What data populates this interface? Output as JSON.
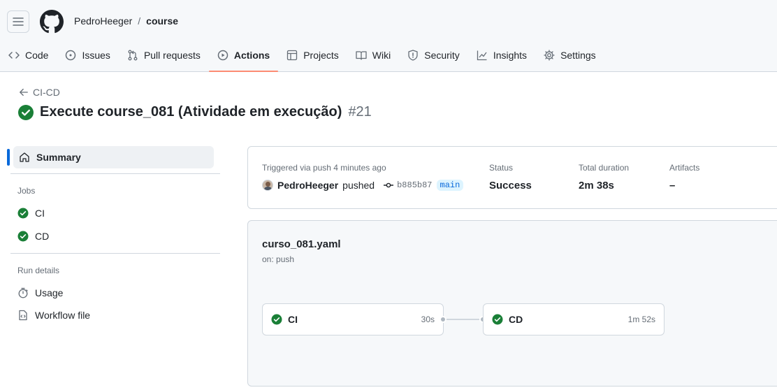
{
  "repo": {
    "owner": "PedroHeeger",
    "separator": "/",
    "name": "course"
  },
  "tabs": [
    {
      "label": "Code",
      "icon": "code-icon"
    },
    {
      "label": "Issues",
      "icon": "issue-icon"
    },
    {
      "label": "Pull requests",
      "icon": "pull-request-icon"
    },
    {
      "label": "Actions",
      "icon": "play-icon",
      "active": true
    },
    {
      "label": "Projects",
      "icon": "table-icon"
    },
    {
      "label": "Wiki",
      "icon": "book-icon"
    },
    {
      "label": "Security",
      "icon": "shield-icon"
    },
    {
      "label": "Insights",
      "icon": "graph-icon"
    },
    {
      "label": "Settings",
      "icon": "gear-icon"
    }
  ],
  "back": {
    "label": "CI-CD"
  },
  "run": {
    "title": "Execute course_081 (Atividade em execução)",
    "number": "#21"
  },
  "sidebar": {
    "summary_label": "Summary",
    "jobs_heading": "Jobs",
    "jobs": [
      {
        "label": "CI"
      },
      {
        "label": "CD"
      }
    ],
    "run_details_heading": "Run details",
    "usage_label": "Usage",
    "workflow_file_label": "Workflow file"
  },
  "summary": {
    "trigger_label": "Triggered via push 4 minutes ago",
    "pusher": "PedroHeeger",
    "action": "pushed",
    "commit": "b885b87",
    "branch": "main",
    "status_label": "Status",
    "status_value": "Success",
    "duration_label": "Total duration",
    "duration_value": "2m 38s",
    "artifacts_label": "Artifacts",
    "artifacts_value": "–"
  },
  "workflow": {
    "file": "curso_081.yaml",
    "trigger": "on: push",
    "jobs": [
      {
        "name": "CI",
        "duration": "30s"
      },
      {
        "name": "CD",
        "duration": "1m 52s"
      }
    ]
  },
  "colors": {
    "success": "#1a7f37",
    "accent": "#0969da",
    "active_tab_underline": "#fd8c73"
  }
}
